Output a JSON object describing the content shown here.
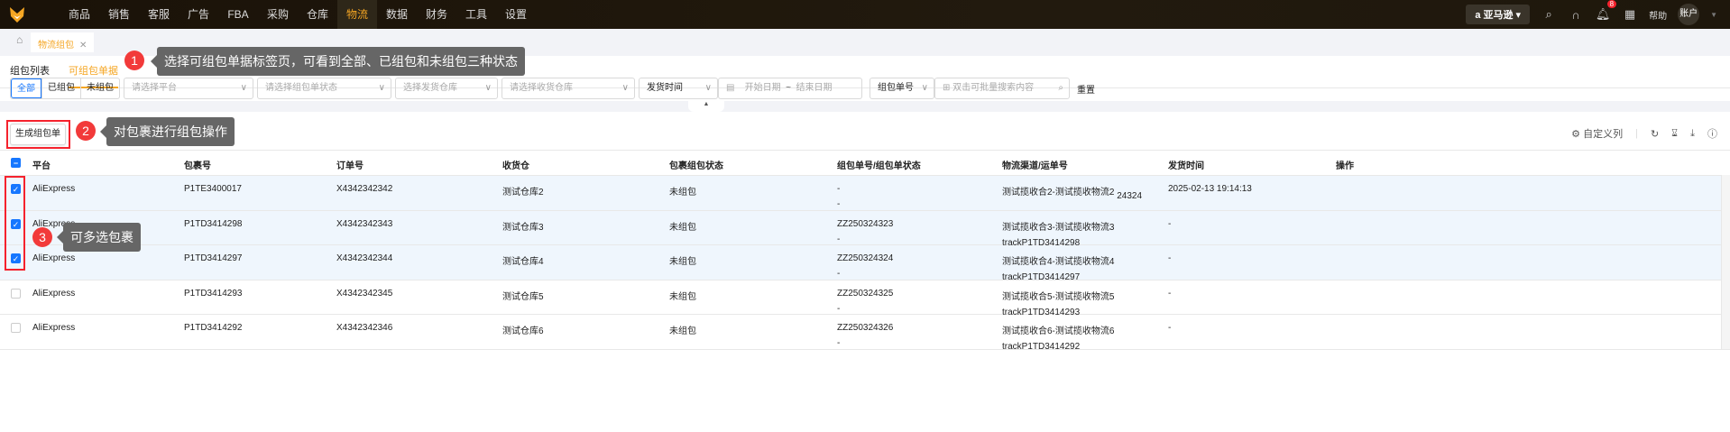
{
  "nav": {
    "items": [
      "商品",
      "销售",
      "客服",
      "广告",
      "FBA",
      "采购",
      "仓库",
      "物流",
      "数据",
      "财务",
      "工具",
      "设置"
    ],
    "active": "物流",
    "shop": "亚马逊",
    "notif_count": "8",
    "help": "帮助",
    "account": "账户"
  },
  "page_tab": "物流组包",
  "subtabs": [
    "组包列表",
    "可组包单据"
  ],
  "filters": {
    "status_segments": [
      "全部",
      "已组包",
      "未组包"
    ],
    "platform_ph": "请选择平台",
    "pack_status_ph": "请选择组包单状态",
    "ship_wh_ph": "选择发货仓库",
    "recv_wh_ph": "请选择收货仓库",
    "time_type": "发货时间",
    "start_ph": "开始日期",
    "tilde": "~",
    "end_ph": "结束日期",
    "search_type": "组包单号",
    "search_ph": "双击可批量搜索内容",
    "reset": "重置"
  },
  "toolbar": {
    "generate": "生成组包单",
    "custom_columns": "自定义列"
  },
  "annotations": [
    {
      "n": "1",
      "text": "选择可组包单据标签页，可看到全部、已组包和未组包三种状态"
    },
    {
      "n": "2",
      "text": "对包裹进行组包操作"
    },
    {
      "n": "3",
      "text": "可多选包裹"
    }
  ],
  "table": {
    "headers": [
      "平台",
      "包裹号",
      "订单号",
      "收货仓",
      "包裹组包状态",
      "组包单号/组包单状态",
      "物流渠道/运单号",
      "发货时间",
      "操作"
    ],
    "rows": [
      {
        "checked": true,
        "platform": "AliExpress",
        "package": "P1TE3400017",
        "order": "X4342342342",
        "wh": "测试仓库2",
        "pstatus": "未组包",
        "pack_no": "-",
        "pack_status": "-",
        "channel": "测试揽收合2-测试揽收物流2",
        "tracking": "24324",
        "time": "2025-02-13 19:14:13"
      },
      {
        "checked": true,
        "platform": "AliExpress",
        "package": "P1TD3414298",
        "order": "X4342342343",
        "wh": "测试仓库3",
        "pstatus": "未组包",
        "pack_no": "ZZ250324323",
        "pack_status": "-",
        "channel": "测试揽收合3-测试揽收物流3",
        "tracking": "trackP1TD3414298",
        "time": "-"
      },
      {
        "checked": true,
        "platform": "AliExpress",
        "package": "P1TD3414297",
        "order": "X4342342344",
        "wh": "测试仓库4",
        "pstatus": "未组包",
        "pack_no": "ZZ250324324",
        "pack_status": "-",
        "channel": "测试揽收合4-测试揽收物流4",
        "tracking": "trackP1TD3414297",
        "time": "-"
      },
      {
        "checked": false,
        "platform": "AliExpress",
        "package": "P1TD3414293",
        "order": "X4342342345",
        "wh": "测试仓库5",
        "pstatus": "未组包",
        "pack_no": "ZZ250324325",
        "pack_status": "-",
        "channel": "测试揽收合5-测试揽收物流5",
        "tracking": "trackP1TD3414293",
        "time": "-"
      },
      {
        "checked": false,
        "platform": "AliExpress",
        "package": "P1TD3414292",
        "order": "X4342342346",
        "wh": "测试仓库6",
        "pstatus": "未组包",
        "pack_no": "ZZ250324326",
        "pack_status": "-",
        "channel": "测试揽收合6-测试揽收物流6",
        "tracking": "trackP1TD3414292",
        "time": "-"
      }
    ]
  }
}
